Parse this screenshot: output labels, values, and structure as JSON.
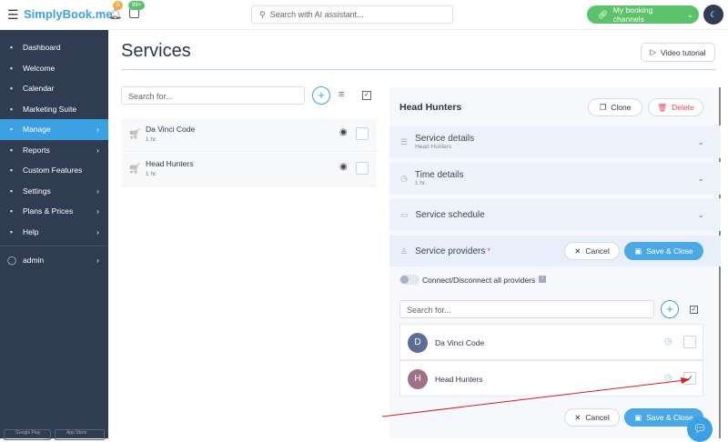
{
  "header": {
    "logo": "SimplyBook.me",
    "notif_badge": "5",
    "calendar_badge": "99+",
    "search_placeholder": "Search with AI assistant...",
    "booking_channels": "My booking channels"
  },
  "sidebar": {
    "items": [
      {
        "label": "Dashboard",
        "icon": "dashboard-icon"
      },
      {
        "label": "Welcome",
        "icon": "bulb-icon"
      },
      {
        "label": "Calendar",
        "icon": "calendar-icon"
      },
      {
        "label": "Marketing Suite",
        "icon": "marketing-icon"
      },
      {
        "label": "Manage",
        "icon": "pencil-icon",
        "active": true,
        "chev": true
      },
      {
        "label": "Reports",
        "icon": "chart-icon",
        "chev": true
      },
      {
        "label": "Custom Features",
        "icon": "puzzle-icon"
      },
      {
        "label": "Settings",
        "icon": "gear-icon",
        "chev": true
      },
      {
        "label": "Plans & Prices",
        "icon": "price-icon",
        "chev": true
      },
      {
        "label": "Help",
        "icon": "help-icon",
        "chev": true
      }
    ],
    "user": "admin",
    "store1": "Google Play",
    "store2": "App Store"
  },
  "page": {
    "title": "Services",
    "video": "Video tutorial",
    "search_placeholder": "Search for..."
  },
  "services": [
    {
      "name": "Da Vinci Code",
      "duration": "1 hr."
    },
    {
      "name": "Head Hunters",
      "duration": "1 hr."
    }
  ],
  "detail": {
    "title": "Head Hunters",
    "clone": "Clone",
    "delete": "Delete",
    "sections": [
      {
        "title": "Service details",
        "sub": "Head Hunters"
      },
      {
        "title": "Time details",
        "sub": "1 hr."
      },
      {
        "title": "Service schedule",
        "sub": ""
      }
    ],
    "providers_title": "Service providers",
    "required": "*",
    "cancel": "Cancel",
    "save": "Save & Close",
    "toggle_label": "Connect/Disconnect all providers",
    "search_placeholder": "Search for...",
    "providers": [
      {
        "initial": "D",
        "name": "Da Vinci Code",
        "color": "#5b6e96",
        "checked": false
      },
      {
        "initial": "H",
        "name": "Head Hunters",
        "color": "#a0708a",
        "checked": true
      }
    ]
  }
}
